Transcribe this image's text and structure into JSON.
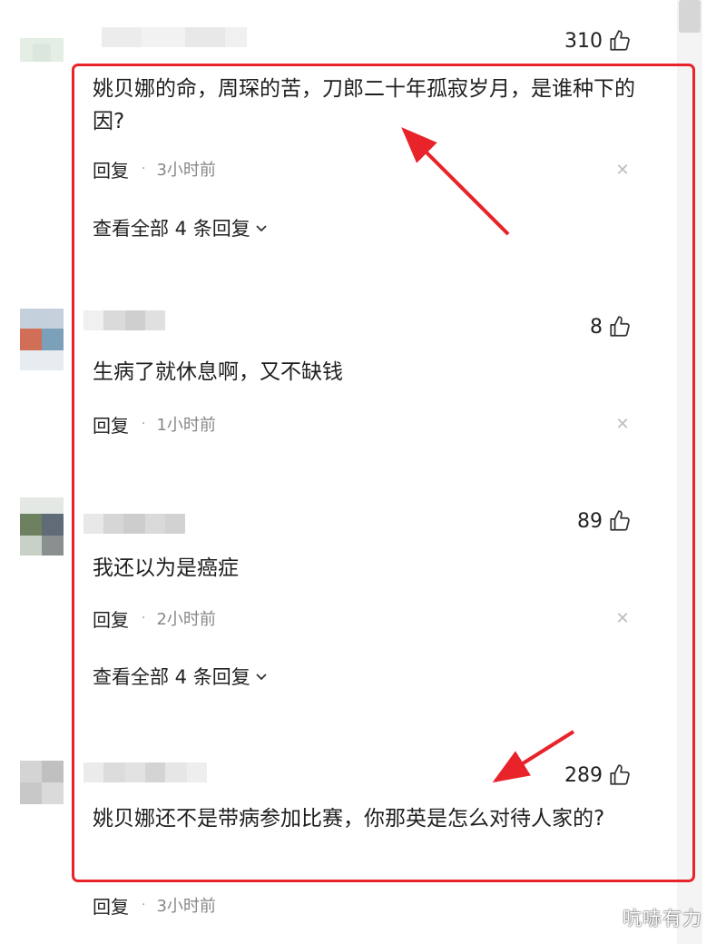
{
  "watermark": "吭哧有力",
  "comments": [
    {
      "likes": "310",
      "text": "姚贝娜的命，周琛的苦，刀郎二十年孤寂岁月，是谁种下的因?",
      "reply_label": "回复",
      "time": "3小时前",
      "view_replies": "查看全部 4 条回复"
    },
    {
      "likes": "8",
      "text": "生病了就休息啊，又不缺钱",
      "reply_label": "回复",
      "time": "1小时前"
    },
    {
      "likes": "89",
      "text": "我还以为是癌症",
      "reply_label": "回复",
      "time": "2小时前",
      "view_replies": "查看全部 4 条回复"
    },
    {
      "likes": "289",
      "text": "姚贝娜还不是带病参加比赛，你那英是怎么对待人家的?",
      "reply_label": "回复",
      "time": "3小时前"
    }
  ],
  "colors": {
    "highlight": "#e8232a"
  },
  "icons": {
    "like": "thumbs-up-icon",
    "close": "close-icon",
    "expand": "chevron-down-icon"
  }
}
